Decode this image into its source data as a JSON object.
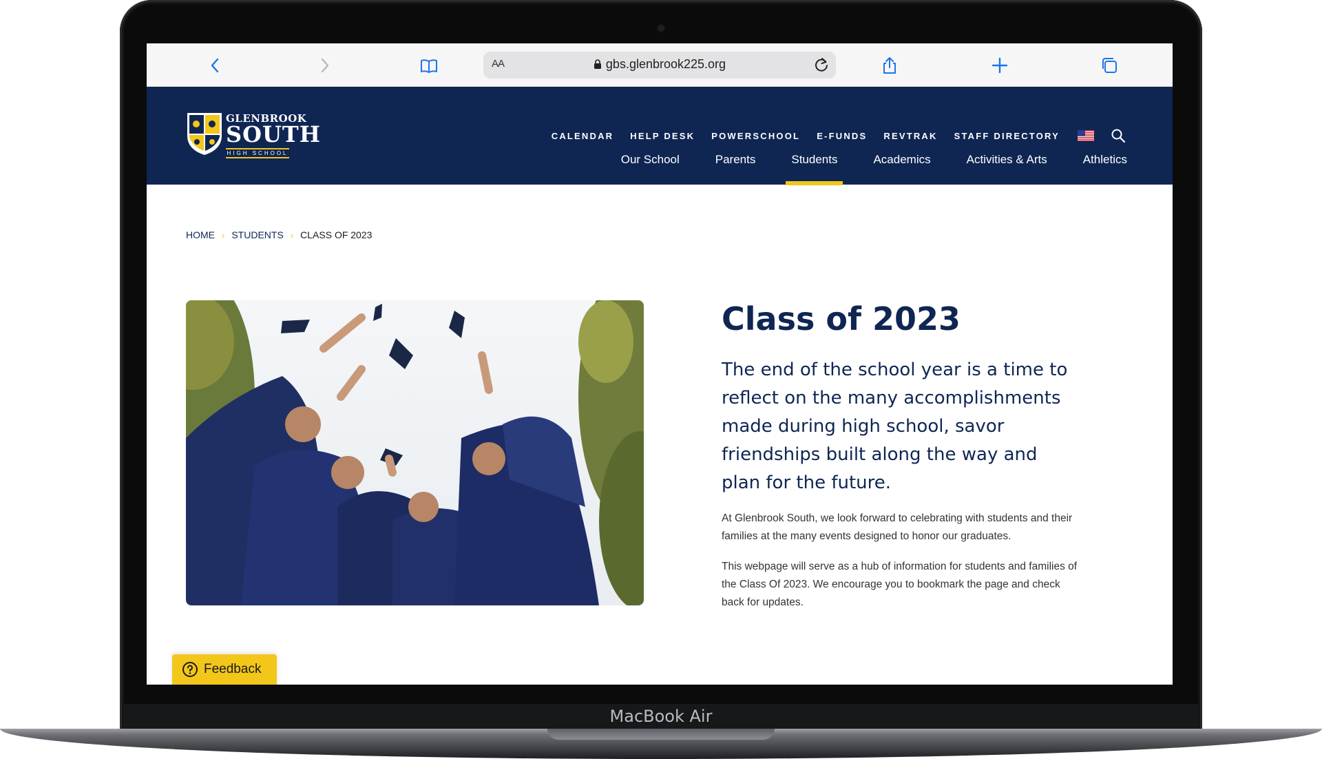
{
  "device": {
    "label": "MacBook Air"
  },
  "browser": {
    "address": {
      "text_size_label": "AA",
      "url": "gbs.glenbrook225.org"
    },
    "icons": [
      "back-icon",
      "forward-icon",
      "bookmarks-icon",
      "reload-icon",
      "share-icon",
      "new-tab-icon",
      "tabs-icon"
    ]
  },
  "site": {
    "logo": {
      "top": "GLENBROOK",
      "main": "SOUTH",
      "sub": "HIGH SCHOOL"
    },
    "utility_nav": [
      "CALENDAR",
      "HELP DESK",
      "POWERSCHOOL",
      "E-FUNDS",
      "REVTRAK",
      "STAFF DIRECTORY"
    ],
    "main_nav": [
      "Our School",
      "Parents",
      "Students",
      "Academics",
      "Activities & Arts",
      "Athletics"
    ],
    "active_nav": "Students",
    "colors": {
      "navy": "#0f2653",
      "gold": "#f3c61a"
    }
  },
  "breadcrumb": [
    "HOME",
    "STUDENTS",
    "CLASS OF 2023"
  ],
  "page": {
    "title": "Class of 2023",
    "lead": "The end of the school year is a time to reflect on the many accomplishments made during high school, savor friendships built along the way and plan for the future.",
    "paragraphs": [
      "At Glenbrook South, we look forward to celebrating with students and their families at the many events designed to honor our graduates.",
      "This webpage will serve as a hub of information for students and families of the Class Of 2023. We encourage you to bookmark the page and check back for updates."
    ]
  },
  "feedback": {
    "label": "Feedback"
  }
}
